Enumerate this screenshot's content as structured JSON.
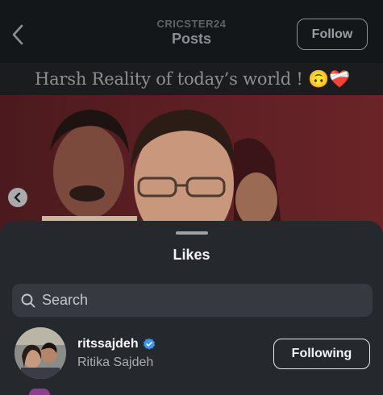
{
  "header": {
    "username": "CRICSTER24",
    "title": "Posts",
    "follow_label": "Follow"
  },
  "post": {
    "caption": "Harsh Reality of today’s world ! 🙃❤️‍🩹"
  },
  "likes_sheet": {
    "title": "Likes",
    "search": {
      "placeholder": "Search",
      "value": ""
    },
    "users": [
      {
        "username": "ritssajdeh",
        "full_name": "Ritika Sajdeh",
        "verified": true,
        "button_label": "Following"
      }
    ]
  },
  "colors": {
    "sheet_background": "#25292e",
    "search_background": "#363a40",
    "verified_badge": "#3897f0",
    "photo_background": "#5a1e22"
  }
}
